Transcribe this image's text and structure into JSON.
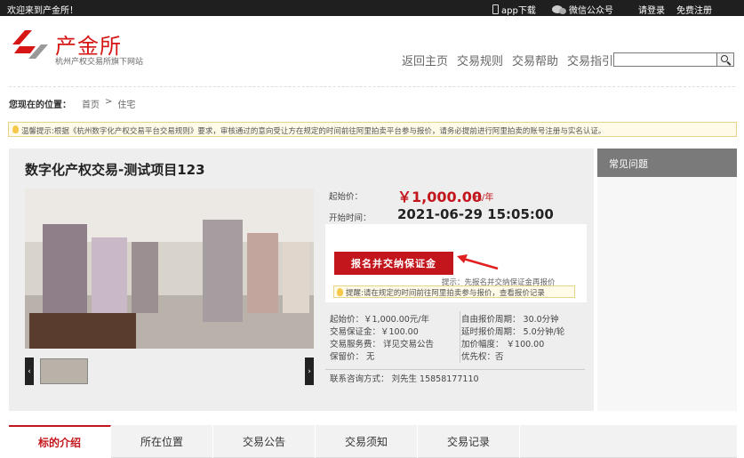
{
  "topbar": {
    "welcome": "欢迎来到产金所！",
    "app_download": "app下载",
    "wechat": "微信公众号",
    "login": "请登录",
    "register": "免费注册"
  },
  "logo": {
    "title": "产金所",
    "subtitle": "杭州产权交易所旗下网站",
    "brand_color": "#d61515"
  },
  "nav": [
    "返回主页",
    "交易规则",
    "交易帮助",
    "交易指引"
  ],
  "search": {
    "placeholder": ""
  },
  "breadcrumb": {
    "label": "您现在的位置：",
    "items": [
      "首页",
      "住宅"
    ],
    "separator": ">"
  },
  "notice": "温馨提示:根据《杭州数字化产权交易平台交易规则》要求，审核通过的意向受让方在规定的时间前往阿里拍卖平台参与报价，请务必提前进行阿里拍卖的账号注册与实名认证。",
  "project": {
    "title": "数字化产权交易-测试项目123",
    "start_price_label": "起始价：",
    "start_price": "￥1,000.00",
    "start_price_unit": "元/年",
    "start_time_label": "开始时间：",
    "start_time": "2021-06-29 15:05:00",
    "register_button": "报名并交纳保证金",
    "hint": "提示：先报名并交纳保证金再报价",
    "remind": "提醒:请在规定的时间前往阿里拍卖参与报价，查看报价记录"
  },
  "details": {
    "left": [
      "起始价：￥1,000.00元/年",
      "交易保证金：￥100.00",
      "交易服务费： 详见交易公告",
      "保留价： 无"
    ],
    "right": [
      "自由报价周期： 30.0分钟",
      "延时报价周期： 5.0分钟/轮",
      "加价幅度： ￥100.00",
      "优先权：否"
    ],
    "contact": "联系咨询方式： 刘先生 15858177110"
  },
  "gallery": {
    "prev": "‹",
    "next": "›"
  },
  "faq": {
    "title": "常见问题"
  },
  "tabs": [
    "标的介绍",
    "所在位置",
    "交易公告",
    "交易须知",
    "交易记录"
  ],
  "colors": {
    "accent_red": "#c3161c",
    "topbar": "#1f1f1f",
    "panel": "#eeeeee"
  }
}
